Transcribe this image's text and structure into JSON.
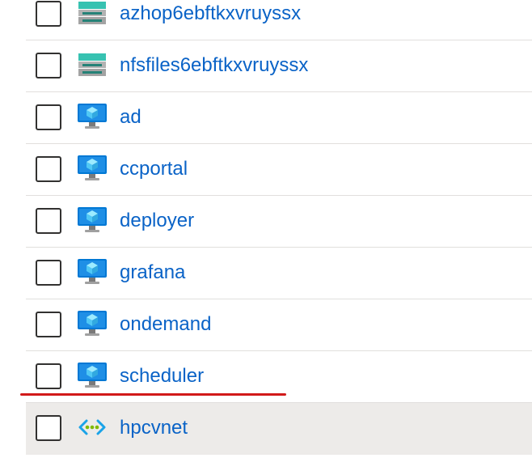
{
  "resources": [
    {
      "name": "azhop6ebftkxvruyssx",
      "icon": "storage-account-icon"
    },
    {
      "name": "nfsfiles6ebftkxvruyssx",
      "icon": "storage-account-icon"
    },
    {
      "name": "ad",
      "icon": "virtual-machine-icon"
    },
    {
      "name": "ccportal",
      "icon": "virtual-machine-icon"
    },
    {
      "name": "deployer",
      "icon": "virtual-machine-icon"
    },
    {
      "name": "grafana",
      "icon": "virtual-machine-icon"
    },
    {
      "name": "ondemand",
      "icon": "virtual-machine-icon"
    },
    {
      "name": "scheduler",
      "icon": "virtual-machine-icon"
    },
    {
      "name": "hpcvnet",
      "icon": "virtual-network-icon"
    }
  ],
  "colors": {
    "link": "#0a63c7",
    "highlight_underline": "#d11a1a",
    "selected_row_bg": "#edebe9"
  }
}
